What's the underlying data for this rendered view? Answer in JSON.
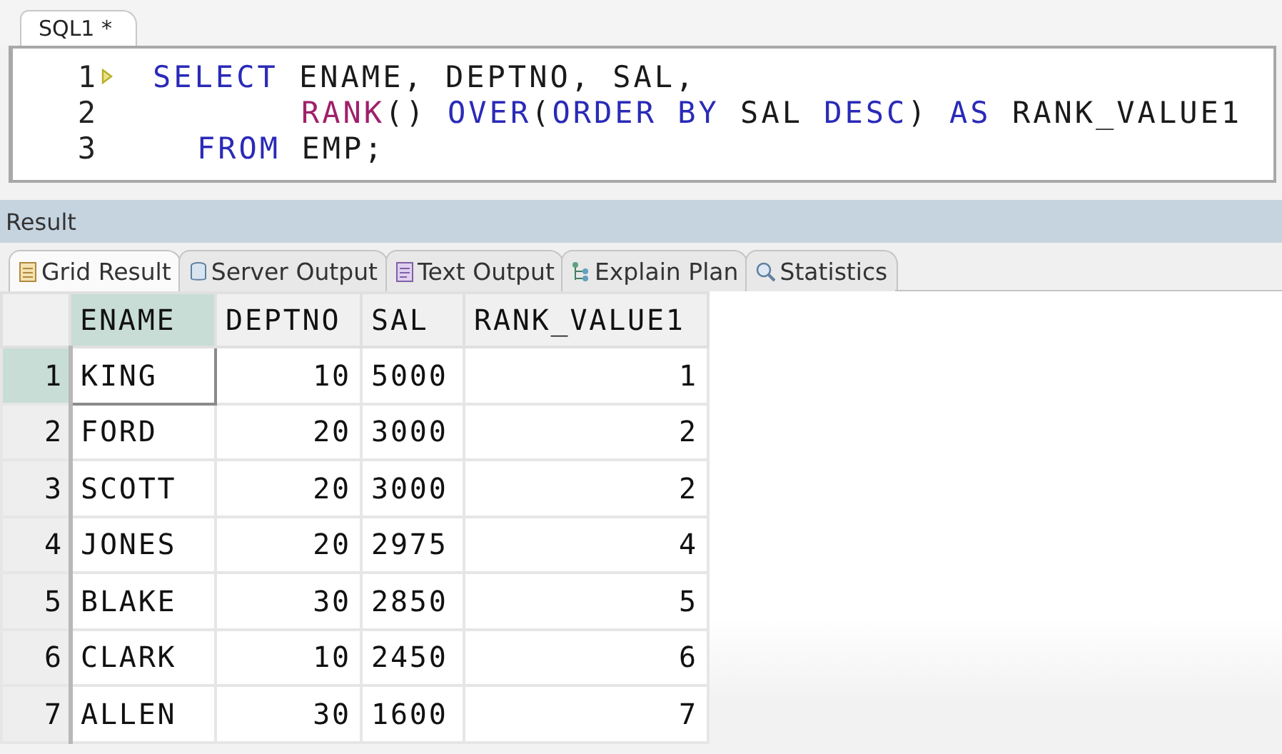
{
  "editor": {
    "tab": {
      "label": "SQL1 *",
      "selected": true
    },
    "lines": [
      {
        "number": "1",
        "current": true,
        "kind": "statement",
        "tokens": [
          {
            "kind": "keyword",
            "text": "SELECT"
          },
          {
            "kind": "plain",
            "text": " ENAME, DEPTNO, SAL,"
          }
        ]
      },
      {
        "number": "2",
        "current": false,
        "kind": "continuation",
        "tokens": [
          {
            "kind": "function",
            "text": "RANK"
          },
          {
            "kind": "plain",
            "text": "() "
          },
          {
            "kind": "keyword",
            "text": "OVER"
          },
          {
            "kind": "plain",
            "text": "("
          },
          {
            "kind": "keyword",
            "text": "ORDER BY"
          },
          {
            "kind": "plain",
            "text": " SAL "
          },
          {
            "kind": "keyword",
            "text": "DESC"
          },
          {
            "kind": "plain",
            "text": ") "
          },
          {
            "kind": "keyword",
            "text": "AS"
          },
          {
            "kind": "plain",
            "text": " RANK_VALUE1"
          }
        ]
      },
      {
        "number": "3",
        "current": false,
        "kind": "clause",
        "tokens": [
          {
            "kind": "keyword",
            "text": "FROM"
          },
          {
            "kind": "plain",
            "text": " EMP;"
          }
        ]
      }
    ]
  },
  "result": {
    "title": "Result",
    "tabs": [
      {
        "label": "Grid Result",
        "selected": true
      },
      {
        "label": "Server Output",
        "selected": false
      },
      {
        "label": "Text Output",
        "selected": false
      },
      {
        "label": "Explain Plan",
        "selected": false
      },
      {
        "label": "Statistics",
        "selected": false
      }
    ],
    "table": {
      "columns": [
        {
          "label": "ENAME",
          "selected": true
        },
        {
          "label": "DEPTNO",
          "selected": false
        },
        {
          "label": "SAL",
          "selected": false
        },
        {
          "label": "RANK_VALUE1",
          "selected": false
        }
      ],
      "rows": [
        {
          "number": "1",
          "selected": true,
          "cells": [
            "KING",
            "10",
            "5000",
            "1"
          ]
        },
        {
          "number": "2",
          "selected": false,
          "cells": [
            "FORD",
            "20",
            "3000",
            "2"
          ]
        },
        {
          "number": "3",
          "selected": false,
          "cells": [
            "SCOTT",
            "20",
            "3000",
            "2"
          ]
        },
        {
          "number": "4",
          "selected": false,
          "cells": [
            "JONES",
            "20",
            "2975",
            "4"
          ]
        },
        {
          "number": "5",
          "selected": false,
          "cells": [
            "BLAKE",
            "30",
            "2850",
            "5"
          ]
        },
        {
          "number": "6",
          "selected": false,
          "cells": [
            "CLARK",
            "10",
            "2450",
            "6"
          ]
        },
        {
          "number": "7",
          "selected": false,
          "cells": [
            "ALLEN",
            "30",
            "1600",
            "7"
          ]
        }
      ]
    }
  }
}
